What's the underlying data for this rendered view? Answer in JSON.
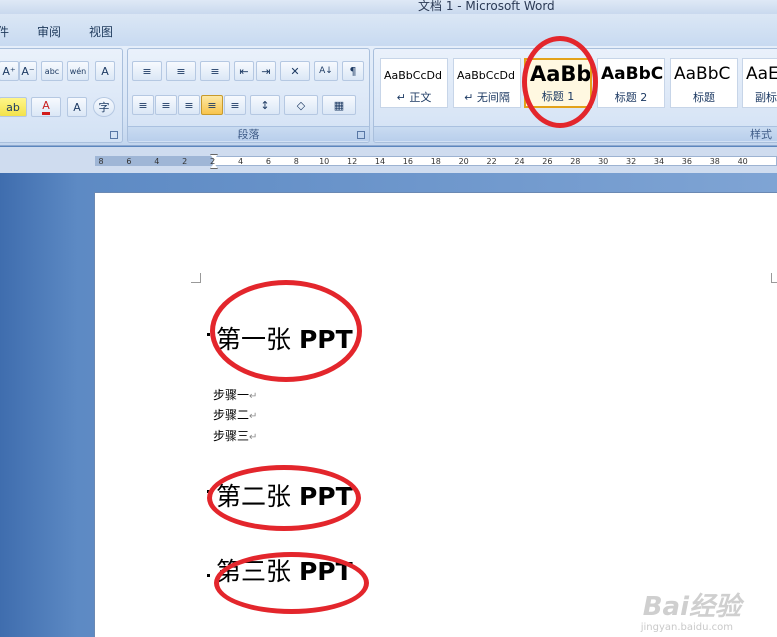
{
  "window": {
    "title": "文档 1 - Microsoft Word"
  },
  "tabs": [
    "件",
    "审阅",
    "视图"
  ],
  "font_group": {
    "row1": [
      "A⁺",
      "A⁻",
      "abc",
      "wén",
      "A"
    ],
    "row2": [
      "ab",
      "A",
      "A",
      "字"
    ]
  },
  "paragraph_group": {
    "label": "段落",
    "row1": [
      "≡",
      "≡",
      "≡",
      "⇤",
      "⇥",
      "✕",
      "A↓",
      "¶"
    ],
    "row2": [
      "≡",
      "≡",
      "≡",
      "≡",
      "≡",
      "↕",
      "◇",
      "▦"
    ]
  },
  "styles_group": {
    "label": "样式",
    "cards": [
      {
        "sample": "AaBbCcDd",
        "name": "↵ 正文"
      },
      {
        "sample": "AaBbCcDd",
        "name": "↵ 无间隔"
      },
      {
        "sample": "AaBb",
        "name": "标题 1"
      },
      {
        "sample": "AaBbC",
        "name": "标题 2"
      },
      {
        "sample": "AaBbC",
        "name": "标题"
      },
      {
        "sample": "AaE",
        "name": "副标"
      }
    ]
  },
  "ruler": {
    "labels": [
      "8",
      "6",
      "4",
      "2",
      "2",
      "4",
      "6",
      "8",
      "10",
      "12",
      "14",
      "16",
      "18",
      "20",
      "22",
      "24",
      "26",
      "28",
      "30",
      "32",
      "34",
      "36",
      "38",
      "40"
    ]
  },
  "document": {
    "headings": [
      {
        "cjk": "第一张",
        "latin": "PPT"
      },
      {
        "cjk": "第二张",
        "latin": "PPT"
      },
      {
        "cjk": "第三张",
        "latin": "PPT"
      }
    ],
    "steps": [
      "步骤一",
      "步骤二",
      "步骤三"
    ],
    "paragraph_mark": "↵"
  },
  "watermark": {
    "brand": "Bai经验",
    "url": "jingyan.baidu.com"
  },
  "annotation_color": "#e3262c"
}
